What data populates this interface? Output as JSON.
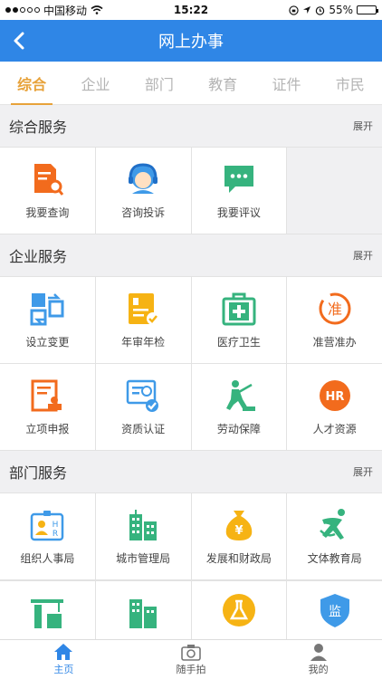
{
  "status": {
    "carrier": "中国移动",
    "time": "15:22",
    "battery": "55%",
    "battery_level": 0.55
  },
  "nav": {
    "title": "网上办事"
  },
  "tabs": [
    "综合",
    "企业",
    "部门",
    "教育",
    "证件",
    "市民"
  ],
  "sections": {
    "general": {
      "title": "综合服务",
      "expand": "展开",
      "items": [
        {
          "label": "我要查询",
          "icon": "document-search-icon"
        },
        {
          "label": "咨询投诉",
          "icon": "customer-service-icon"
        },
        {
          "label": "我要评议",
          "icon": "chat-bubble-icon"
        }
      ]
    },
    "enterprise": {
      "title": "企业服务",
      "expand": "展开",
      "items": [
        {
          "label": "设立变更",
          "icon": "swap-blocks-icon"
        },
        {
          "label": "年审年检",
          "icon": "approved-document-icon"
        },
        {
          "label": "医疗卫生",
          "icon": "medical-kit-icon"
        },
        {
          "label": "准营准办",
          "icon": "permit-stamp-icon"
        },
        {
          "label": "立项申报",
          "icon": "project-application-icon"
        },
        {
          "label": "资质认证",
          "icon": "certificate-icon"
        },
        {
          "label": "劳动保障",
          "icon": "worker-icon"
        },
        {
          "label": "人才资源",
          "icon": "hr-badge-icon"
        }
      ]
    },
    "department": {
      "title": "部门服务",
      "expand": "展开",
      "items": [
        {
          "label": "组织人事局",
          "icon": "personnel-card-icon"
        },
        {
          "label": "城市管理局",
          "icon": "city-buildings-icon"
        },
        {
          "label": "发展和财政局",
          "icon": "money-bag-icon"
        },
        {
          "label": "文体教育局",
          "icon": "sports-figure-icon"
        }
      ],
      "partial_items": [
        {
          "icon": "construction-crane-icon"
        },
        {
          "icon": "buildings-icon"
        },
        {
          "icon": "flask-icon"
        },
        {
          "label": "监",
          "icon": "supervision-shield-icon"
        }
      ]
    }
  },
  "bottom_nav": [
    {
      "label": "主页",
      "icon": "home-icon"
    },
    {
      "label": "随手拍",
      "icon": "camera-icon"
    },
    {
      "label": "我的",
      "icon": "user-icon"
    }
  ],
  "colors": {
    "primary": "#2f86e6",
    "tab_active": "#e7a23a",
    "orange": "#f26b1d",
    "green": "#36b37e",
    "yellow": "#f6b314",
    "blue": "#3f9ae8"
  }
}
